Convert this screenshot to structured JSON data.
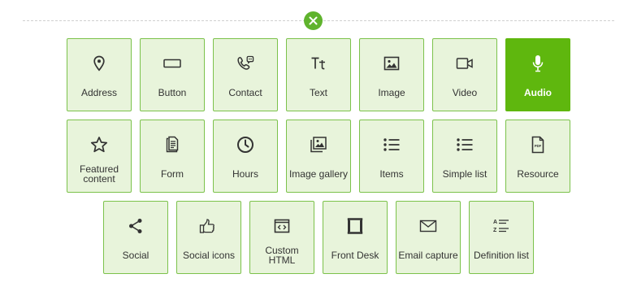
{
  "close": {
    "label": "×"
  },
  "tiles": [
    {
      "label": "Address",
      "icon": "location-pin-icon"
    },
    {
      "label": "Button",
      "icon": "button-rectangle-icon"
    },
    {
      "label": "Contact",
      "icon": "phone-chat-icon"
    },
    {
      "label": "Text",
      "icon": "text-tt-icon"
    },
    {
      "label": "Image",
      "icon": "image-icon"
    },
    {
      "label": "Video",
      "icon": "video-camera-icon"
    },
    {
      "label": "Audio",
      "icon": "microphone-icon",
      "selected": true
    },
    {
      "label": "Featured content",
      "icon": "star-icon"
    },
    {
      "label": "Form",
      "icon": "form-document-icon"
    },
    {
      "label": "Hours",
      "icon": "clock-icon"
    },
    {
      "label": "Image gallery",
      "icon": "image-gallery-icon"
    },
    {
      "label": "Items",
      "icon": "bulleted-list-icon"
    },
    {
      "label": "Simple list",
      "icon": "simple-list-icon"
    },
    {
      "label": "Resource",
      "icon": "pdf-file-icon"
    },
    {
      "label": "Social",
      "icon": "share-icon"
    },
    {
      "label": "Social icons",
      "icon": "thumbs-up-icon"
    },
    {
      "label": "Custom HTML",
      "icon": "code-window-icon"
    },
    {
      "label": "Front Desk",
      "icon": "front-desk-frame-icon"
    },
    {
      "label": "Email capture",
      "icon": "envelope-icon"
    },
    {
      "label": "Definition list",
      "icon": "definition-list-icon"
    }
  ],
  "colors": {
    "accent": "#5fb70e",
    "tile_bg": "#e8f4db",
    "tile_border": "#7cc24b"
  }
}
